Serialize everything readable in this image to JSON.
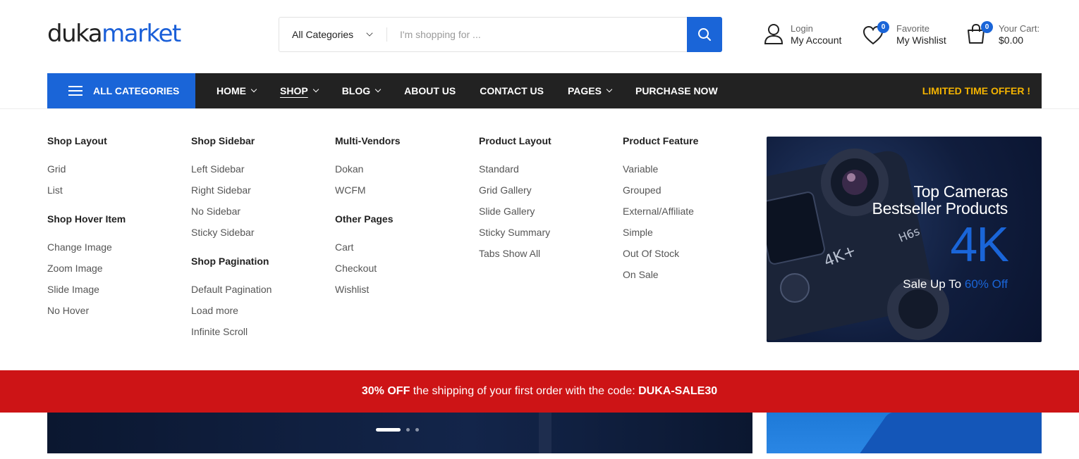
{
  "logo": {
    "part1": "duka",
    "part2": "market"
  },
  "search": {
    "category": "All Categories",
    "placeholder": "I'm shopping for ..."
  },
  "account": {
    "small": "Login",
    "big": "My Account"
  },
  "wishlist": {
    "small": "Favorite",
    "big": "My Wishlist",
    "count": "0"
  },
  "cart": {
    "small": "Your Cart:",
    "big": "$0.00",
    "count": "0"
  },
  "nav": {
    "all_categories": "ALL CATEGORIES",
    "items": [
      {
        "label": "HOME"
      },
      {
        "label": "SHOP"
      },
      {
        "label": "BLOG"
      },
      {
        "label": "ABOUT US"
      },
      {
        "label": "CONTACT US"
      },
      {
        "label": "PAGES"
      },
      {
        "label": "PURCHASE NOW"
      }
    ],
    "offer": "LIMITED TIME OFFER !"
  },
  "mega": {
    "shop_layout": {
      "title": "Shop Layout",
      "links": [
        "Grid",
        "List"
      ]
    },
    "shop_hover": {
      "title": "Shop Hover Item",
      "links": [
        "Change Image",
        "Zoom Image",
        "Slide Image",
        "No Hover"
      ]
    },
    "shop_sidebar": {
      "title": "Shop Sidebar",
      "links": [
        "Left Sidebar",
        "Right Sidebar",
        "No Sidebar",
        "Sticky Sidebar"
      ]
    },
    "shop_pagination": {
      "title": "Shop Pagination",
      "links": [
        "Default Pagination",
        "Load more",
        "Infinite Scroll"
      ]
    },
    "multi_vendors": {
      "title": "Multi-Vendors",
      "links": [
        "Dokan",
        "WCFM"
      ]
    },
    "other_pages": {
      "title": "Other Pages",
      "links": [
        "Cart",
        "Checkout",
        "Wishlist"
      ]
    },
    "product_layout": {
      "title": "Product Layout",
      "links": [
        "Standard",
        "Grid Gallery",
        "Slide Gallery",
        "Sticky Summary",
        "Tabs Show All"
      ]
    },
    "product_feature": {
      "title": "Product Feature",
      "links": [
        "Variable",
        "Grouped",
        "External/Affiliate",
        "Simple",
        "Out Of Stock",
        "On Sale"
      ]
    }
  },
  "banner": {
    "line1": "Top Cameras",
    "line2": "Bestseller Products",
    "big": "4K",
    "sale_prefix": "Sale Up To",
    "sale_highlight": "60% Off"
  },
  "promo": {
    "strong1": "30% OFF",
    "text": "the shipping of your first order with the code:",
    "code": "DUKA-SALE30"
  },
  "colors": {
    "accent": "#1a65d8",
    "nav_bg": "#222222",
    "offer": "#f5b400",
    "promo_bg": "#cd1416"
  }
}
